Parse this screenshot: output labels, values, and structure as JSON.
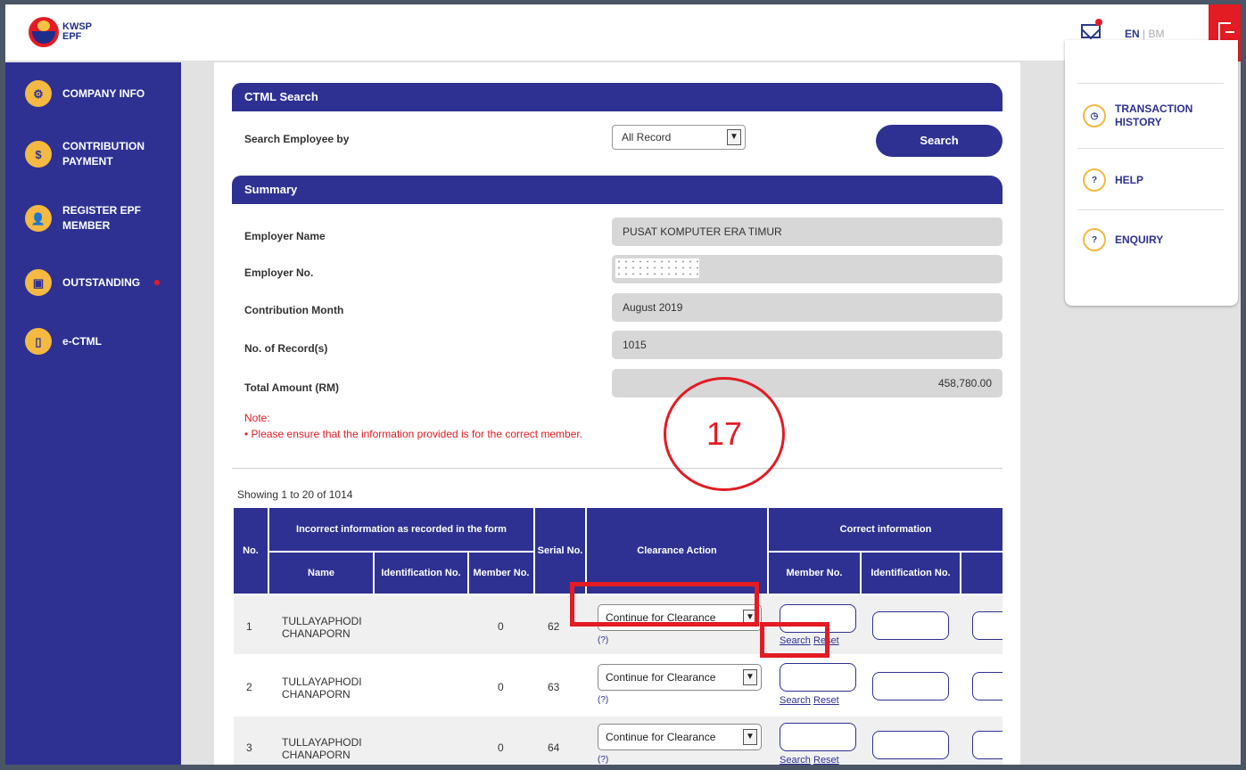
{
  "header": {
    "logo_line1": "KWSP",
    "logo_line2": "EPF",
    "lang_en": "EN",
    "lang_sep": " | ",
    "lang_bm": "BM"
  },
  "sidebar": {
    "items": [
      {
        "label": "COMPANY INFO",
        "icon": "gear-icon"
      },
      {
        "label": "CONTRIBUTION PAYMENT",
        "icon": "dollar-icon"
      },
      {
        "label": "REGISTER EPF MEMBER",
        "icon": "user-add-icon"
      },
      {
        "label": "OUTSTANDING",
        "icon": "folder-icon"
      },
      {
        "label": "e-CTML",
        "icon": "document-icon"
      }
    ]
  },
  "ctml_search": {
    "title": "CTML Search",
    "search_by_label": "Search Employee by",
    "select_value": "All Record",
    "search_button": "Search"
  },
  "summary": {
    "title": "Summary",
    "employer_name_label": "Employer Name",
    "employer_name": "PUSAT KOMPUTER ERA TIMUR",
    "employer_no_label": "Employer No.",
    "employer_no": "",
    "contribution_month_label": "Contribution Month",
    "contribution_month": "August 2019",
    "records_label": "No. of Record(s)",
    "records": "1015",
    "total_label": "Total Amount (RM)",
    "total": "458,780.00",
    "note_label": "Note:",
    "note_text": "• Please ensure that the information provided is for the correct member."
  },
  "table": {
    "showing": "Showing 1 to 20 of 1014",
    "headers": {
      "no": "No.",
      "incorrect_group": "Incorrect information as recorded in the form",
      "name": "Name",
      "identification": "Identification No.",
      "member": "Member No.",
      "serial": "Serial No.",
      "clearance": "Clearance Action",
      "correct_group": "Correct information",
      "correct_member": "Member No.",
      "correct_identification": "Identification No."
    },
    "rows": [
      {
        "no": "1",
        "name": "TULLAYAPHODI CHANAPORN",
        "member": "0",
        "serial": "62",
        "action": "Continue for Clearance",
        "qmark": "(?)",
        "search": "Search",
        "reset": "Reset"
      },
      {
        "no": "2",
        "name": "TULLAYAPHODI CHANAPORN",
        "member": "0",
        "serial": "63",
        "action": "Continue for Clearance",
        "qmark": "(?)",
        "search": "Search",
        "reset": "Reset"
      },
      {
        "no": "3",
        "name": "TULLAYAPHODI CHANAPORN",
        "member": "0",
        "serial": "64",
        "action": "Continue for Clearance",
        "qmark": "(?)",
        "search": "Search",
        "reset": "Reset"
      }
    ]
  },
  "right_panel": {
    "items": [
      {
        "label": "TRANSACTION HISTORY",
        "icon": "history-icon"
      },
      {
        "label": "HELP",
        "icon": "help-icon"
      },
      {
        "label": "ENQUIRY",
        "icon": "enquiry-icon"
      }
    ]
  },
  "annotation": {
    "step": "17"
  },
  "colors": {
    "primary": "#2e3192",
    "accent": "#f4b942",
    "alert": "#e31b23"
  }
}
